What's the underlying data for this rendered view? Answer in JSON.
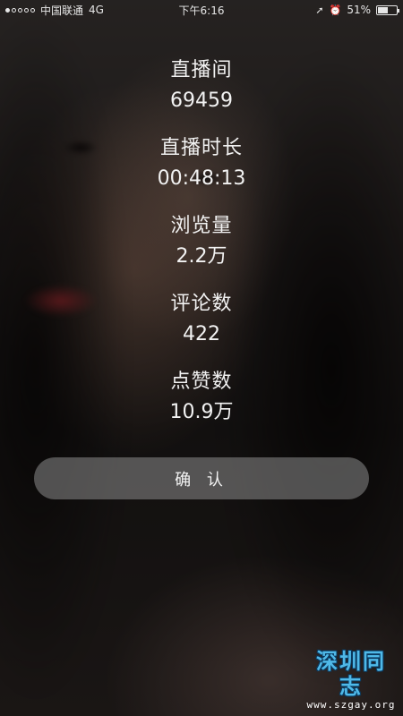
{
  "status_bar": {
    "signal_strength": "1 of 5",
    "carrier": "中国联通",
    "network": "4G",
    "time": "下午6:16",
    "battery_percent": "51%"
  },
  "stats": [
    {
      "label": "直播间",
      "value": "69459"
    },
    {
      "label": "直播时长",
      "value": "00:48:13"
    },
    {
      "label": "浏览量",
      "value": "2.2万"
    },
    {
      "label": "评论数",
      "value": "422"
    },
    {
      "label": "点赞数",
      "value": "10.9万"
    }
  ],
  "confirm_label": "确 认",
  "watermark": {
    "title": "深圳同志",
    "url": "www.szgay.org"
  },
  "colors": {
    "watermark_title": "#4fb9e8",
    "button_bg": "rgba(140,140,140,0.55)"
  }
}
